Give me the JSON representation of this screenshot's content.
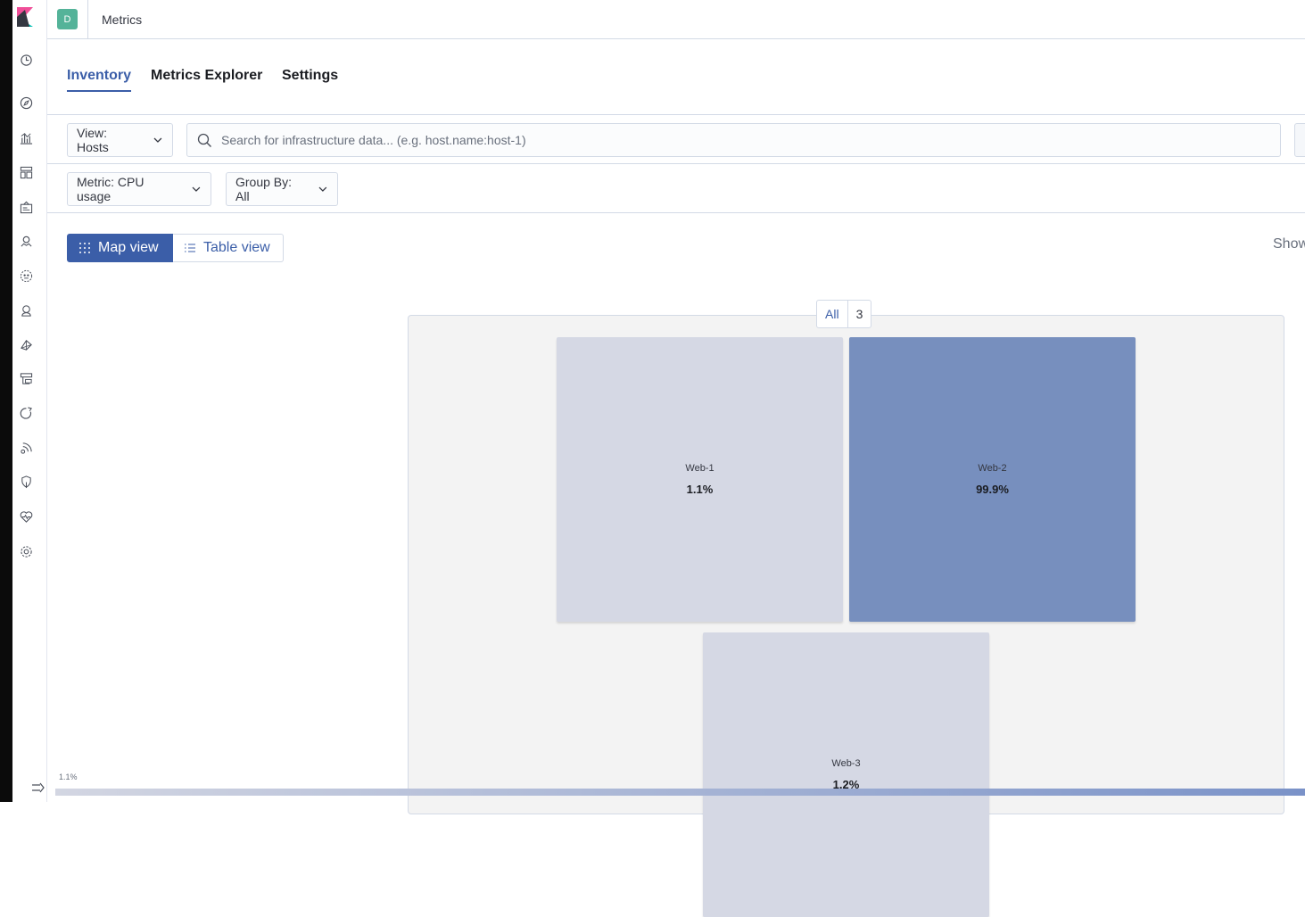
{
  "header": {
    "space_initial": "D",
    "breadcrumb": "Metrics"
  },
  "tabs": [
    {
      "label": "Inventory",
      "selected": true
    },
    {
      "label": "Metrics Explorer",
      "selected": false
    },
    {
      "label": "Settings",
      "selected": false
    }
  ],
  "toolbar": {
    "view_dropdown": "View: Hosts",
    "search_placeholder": "Search for infrastructure data... (e.g. host.name:host-1)",
    "metric_dropdown": "Metric: CPU usage",
    "groupby_dropdown": "Group By: All"
  },
  "view_toggle": {
    "map_label": "Map view",
    "table_label": "Table view",
    "selected": "map"
  },
  "show_label": "Show",
  "group": {
    "label": "All",
    "count": "3"
  },
  "nodes": [
    {
      "name": "Web-1",
      "value": "1.1%",
      "color": "#d5d8e4"
    },
    {
      "name": "Web-2",
      "value": "99.9%",
      "color": "#778fbe"
    },
    {
      "name": "Web-3",
      "value": "1.2%",
      "color": "#d5d8e4"
    }
  ],
  "legend": {
    "min_label": "1.1%",
    "min_color": "#d3d6e2",
    "max_color": "#7a92c8"
  },
  "nav_icons": [
    "clock-icon",
    "compass-icon",
    "visualize-icon",
    "dashboard-icon",
    "canvas-icon",
    "maps-icon",
    "ml-icon",
    "graph-icon",
    "metrics-icon",
    "logs-icon",
    "apm-icon",
    "uptime-icon",
    "siem-icon",
    "monitoring-icon",
    "management-icon"
  ],
  "colors": {
    "accent": "#3b5ea8",
    "space_avatar": "#54b399"
  }
}
